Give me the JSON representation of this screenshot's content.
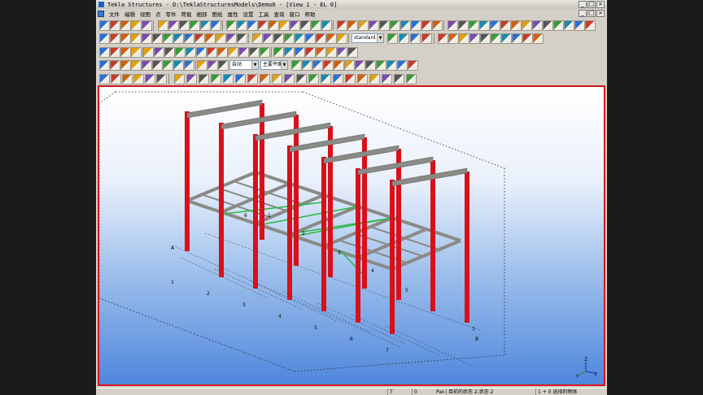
{
  "window": {
    "title": "Tekla Structures - D:\\TeklaStructuresModels\\Demo0 - [View 1 - EL 0]",
    "min_glyph": "_",
    "max_glyph": "□",
    "close_glyph": "×"
  },
  "menu": [
    "文件",
    "编辑",
    "视图",
    "点",
    "零件",
    "荷载",
    "细部",
    "图纸",
    "属性",
    "设置",
    "工具",
    "查询",
    "窗口",
    "帮助"
  ],
  "toolbars": {
    "row2_combo": "standard",
    "row4_combo1": "自动",
    "row4_combo2": "主要平面"
  },
  "model": {
    "grid_labels": {
      "row_letters": [
        "A",
        "B"
      ],
      "axis_numbers": [
        "1",
        "2",
        "3",
        "4",
        "5",
        "6",
        "7"
      ],
      "brace_labels": [
        "1",
        "2",
        "3",
        "4",
        "5"
      ],
      "marker_label": "6"
    },
    "axis_indicator": [
      "Z",
      "Y",
      "X"
    ],
    "colors": {
      "column": "#d8101a",
      "beam": "#8a8a86",
      "brace": "#2eb847",
      "view_frame": "#d8141c"
    }
  },
  "statusbar": {
    "f1": "T",
    "f2": "0",
    "f3": "Pan",
    "f4": "目前的状态 2,状态 2",
    "f5": "1 + 0 选择的物体"
  }
}
